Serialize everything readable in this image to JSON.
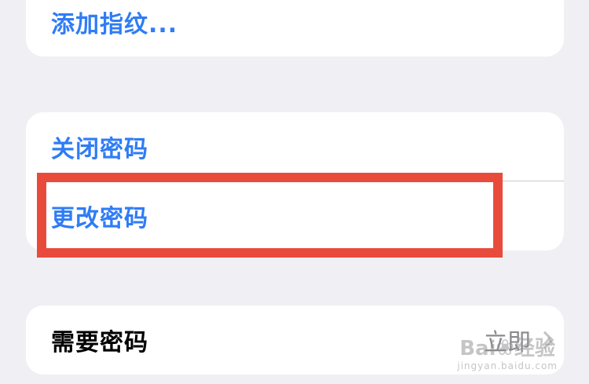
{
  "settings": {
    "fingerprint_group": {
      "add_fingerprint_label": "添加指纹..."
    },
    "passcode_group": {
      "turn_off_label": "关闭密码",
      "change_label": "更改密码"
    },
    "require_group": {
      "require_label": "需要密码",
      "require_value": "立即"
    }
  },
  "annotation": {
    "highlight_color": "#e84b3c",
    "highlighted_item": "更改密码"
  },
  "watermark": {
    "brand": "Bai",
    "brand_suffix": "经验",
    "url": "jingyan.baidu.com"
  },
  "colors": {
    "background": "#efeff4",
    "link_blue": "#2f7cf6",
    "text_dark": "#000000",
    "secondary_gray": "#8a8a8e"
  }
}
